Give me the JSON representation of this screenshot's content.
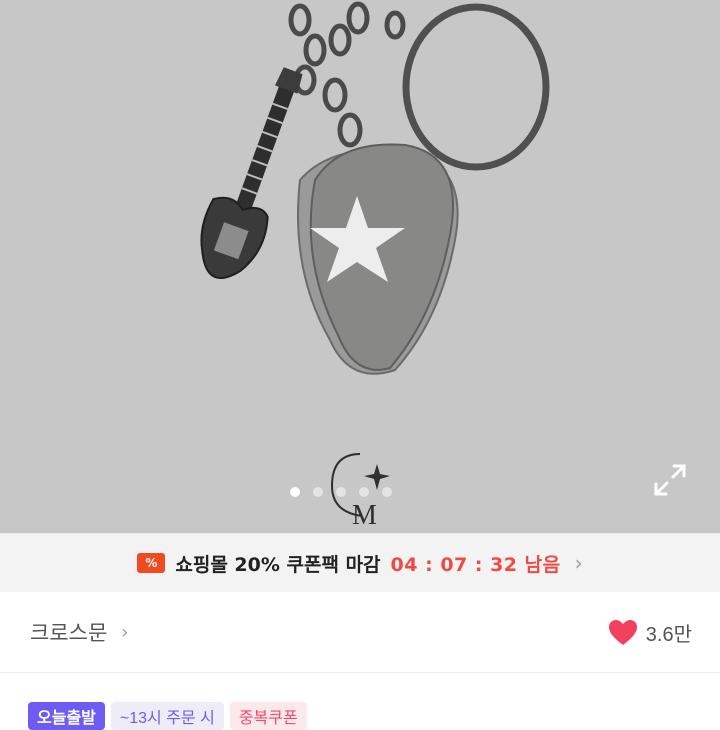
{
  "hero": {
    "image_desc_icon": "guitar-and-pick-keyring",
    "logo_letters": "CM",
    "carousel_count": 5,
    "carousel_active": 1,
    "expand_icon": "expand-icon"
  },
  "coupon": {
    "icon_symbol": "%",
    "text": "쇼핑몰 20% 쿠폰팩 마감",
    "timer": "04 : 07 : 32 남음",
    "arrow": "›"
  },
  "seller": {
    "name": "크로스문",
    "arrow": "›",
    "likes": "3.6만",
    "heart_color": "#f2405f"
  },
  "tags": [
    {
      "label": "오늘출발"
    },
    {
      "label": "~13시 주문 시"
    },
    {
      "label": "중복쿠폰"
    }
  ],
  "colors": {
    "accent": "#f04a44",
    "brand_purple": "#6d5cf2"
  }
}
